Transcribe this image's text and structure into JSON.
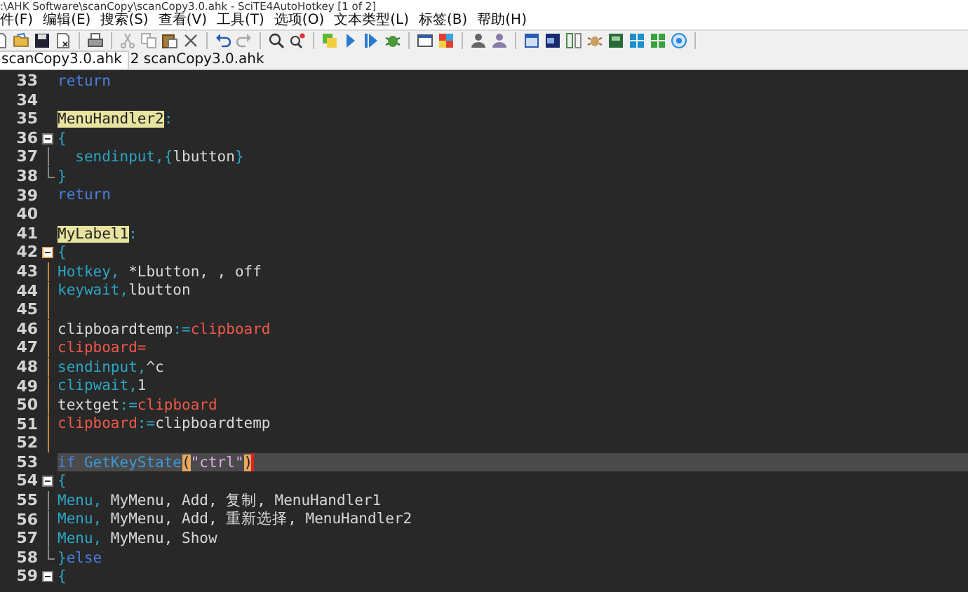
{
  "window": {
    "title": ":\\AHK Software\\scanCopy\\scanCopy3.0.ahk - SciTE4AutoHotkey [1 of 2]"
  },
  "menu": [
    "件(F)",
    "编辑(E)",
    "搜索(S)",
    "查看(V)",
    "工具(T)",
    "选项(O)",
    "文本类型(L)",
    "标签(B)",
    "帮助(H)"
  ],
  "tabs": [
    {
      "label": "scanCopy3.0.ahk",
      "selected": true
    },
    {
      "label": "2 scanCopy3.0.ahk",
      "selected": false
    }
  ],
  "editor": {
    "lines": [
      {
        "number": "33",
        "current": false,
        "tokens": [
          {
            "kind": "kw",
            "text": "return"
          }
        ]
      },
      {
        "number": "34",
        "current": false
      },
      {
        "number": "35",
        "current": false,
        "tokens": [
          {
            "kind": "label",
            "text": "MenuHandler2"
          },
          {
            "kind": "op",
            "text": ":"
          }
        ]
      },
      {
        "number": "36",
        "current": false,
        "fold": {
          "kind": "box",
          "active": false
        },
        "tokens": [
          {
            "kind": "cmd",
            "text": "{"
          }
        ]
      },
      {
        "number": "37",
        "current": false,
        "fold": {
          "kind": "line",
          "active": false
        },
        "tokens": [
          {
            "kind": "cmd",
            "text": "  sendinput,{"
          },
          {
            "kind": "var",
            "text": "lbutton"
          },
          {
            "kind": "cmd",
            "text": "}"
          }
        ]
      },
      {
        "number": "38",
        "current": false,
        "fold": {
          "kind": "end",
          "active": false
        },
        "tokens": [
          {
            "kind": "cmd",
            "text": "}"
          }
        ]
      },
      {
        "number": "39",
        "current": false,
        "tokens": [
          {
            "kind": "kw",
            "text": "return"
          }
        ]
      },
      {
        "number": "40",
        "current": false
      },
      {
        "number": "41",
        "current": false,
        "tokens": [
          {
            "kind": "label",
            "text": "MyLabel1"
          },
          {
            "kind": "op",
            "text": ":"
          }
        ]
      },
      {
        "number": "42",
        "current": false,
        "fold": {
          "kind": "box",
          "active": true
        },
        "tokens": [
          {
            "kind": "cmd",
            "text": "{"
          }
        ]
      },
      {
        "number": "43",
        "current": false,
        "fold": {
          "kind": "line",
          "active": true
        },
        "tokens": [
          {
            "kind": "cmd",
            "text": "Hotkey,"
          },
          {
            "kind": "var",
            "text": " *Lbutton, , off"
          }
        ]
      },
      {
        "number": "44",
        "current": false,
        "fold": {
          "kind": "line",
          "active": true
        },
        "tokens": [
          {
            "kind": "cmd",
            "text": "keywait,"
          },
          {
            "kind": "var",
            "text": "lbutton"
          }
        ]
      },
      {
        "number": "45",
        "current": false,
        "fold": {
          "kind": "line",
          "active": true
        }
      },
      {
        "number": "46",
        "current": false,
        "fold": {
          "kind": "line",
          "active": true
        },
        "tokens": [
          {
            "kind": "var",
            "text": "clipboardtemp"
          },
          {
            "kind": "op",
            "text": ":="
          },
          {
            "kind": "builtin",
            "text": "clipboard"
          }
        ]
      },
      {
        "number": "47",
        "current": false,
        "fold": {
          "kind": "line",
          "active": true
        },
        "tokens": [
          {
            "kind": "builtin",
            "text": "clipboard="
          }
        ]
      },
      {
        "number": "48",
        "current": false,
        "fold": {
          "kind": "line",
          "active": true
        },
        "tokens": [
          {
            "kind": "cmd",
            "text": "sendinput,"
          },
          {
            "kind": "var",
            "text": "^c"
          }
        ]
      },
      {
        "number": "49",
        "current": false,
        "fold": {
          "kind": "line",
          "active": true
        },
        "tokens": [
          {
            "kind": "cmd",
            "text": "clipwait,"
          },
          {
            "kind": "var",
            "text": "1"
          }
        ]
      },
      {
        "number": "50",
        "current": false,
        "fold": {
          "kind": "line",
          "active": true
        },
        "tokens": [
          {
            "kind": "var",
            "text": "textget"
          },
          {
            "kind": "op",
            "text": ":="
          },
          {
            "kind": "builtin",
            "text": "clipboard"
          }
        ]
      },
      {
        "number": "51",
        "current": false,
        "fold": {
          "kind": "line",
          "active": true
        },
        "tokens": [
          {
            "kind": "builtin",
            "text": "clipboard"
          },
          {
            "kind": "op",
            "text": ":="
          },
          {
            "kind": "var",
            "text": "clipboardtemp"
          }
        ]
      },
      {
        "number": "52",
        "current": false,
        "fold": {
          "kind": "line",
          "active": true
        }
      },
      {
        "number": "53",
        "current": true,
        "tokens": [
          {
            "kind": "kw",
            "text": "if "
          },
          {
            "kind": "func",
            "text": "GetKeyState"
          },
          {
            "kind": "paren",
            "text": "("
          },
          {
            "kind": "str",
            "text": "\"ctrl\""
          },
          {
            "kind": "paren",
            "text": ")"
          }
        ]
      },
      {
        "number": "54",
        "current": false,
        "fold": {
          "kind": "box",
          "active": false
        },
        "tokens": [
          {
            "kind": "cmd",
            "text": "{"
          }
        ]
      },
      {
        "number": "55",
        "current": false,
        "fold": {
          "kind": "line",
          "active": false
        },
        "tokens": [
          {
            "kind": "cmd",
            "text": "Menu,"
          },
          {
            "kind": "var",
            "text": " MyMenu, Add, 复制, MenuHandler1"
          }
        ]
      },
      {
        "number": "56",
        "current": false,
        "fold": {
          "kind": "line",
          "active": false
        },
        "tokens": [
          {
            "kind": "cmd",
            "text": "Menu,"
          },
          {
            "kind": "var",
            "text": " MyMenu, Add, 重新选择, MenuHandler2"
          }
        ]
      },
      {
        "number": "57",
        "current": false,
        "fold": {
          "kind": "line",
          "active": false
        },
        "tokens": [
          {
            "kind": "cmd",
            "text": "Menu,"
          },
          {
            "kind": "var",
            "text": " MyMenu, Show"
          }
        ]
      },
      {
        "number": "58",
        "current": false,
        "fold": {
          "kind": "end",
          "active": false
        },
        "tokens": [
          {
            "kind": "cmd",
            "text": "}"
          },
          {
            "kind": "kw",
            "text": "else"
          }
        ]
      },
      {
        "number": "59",
        "current": false,
        "fold": {
          "kind": "box",
          "active": false
        },
        "tokens": [
          {
            "kind": "cmd",
            "text": "{"
          }
        ]
      }
    ]
  }
}
